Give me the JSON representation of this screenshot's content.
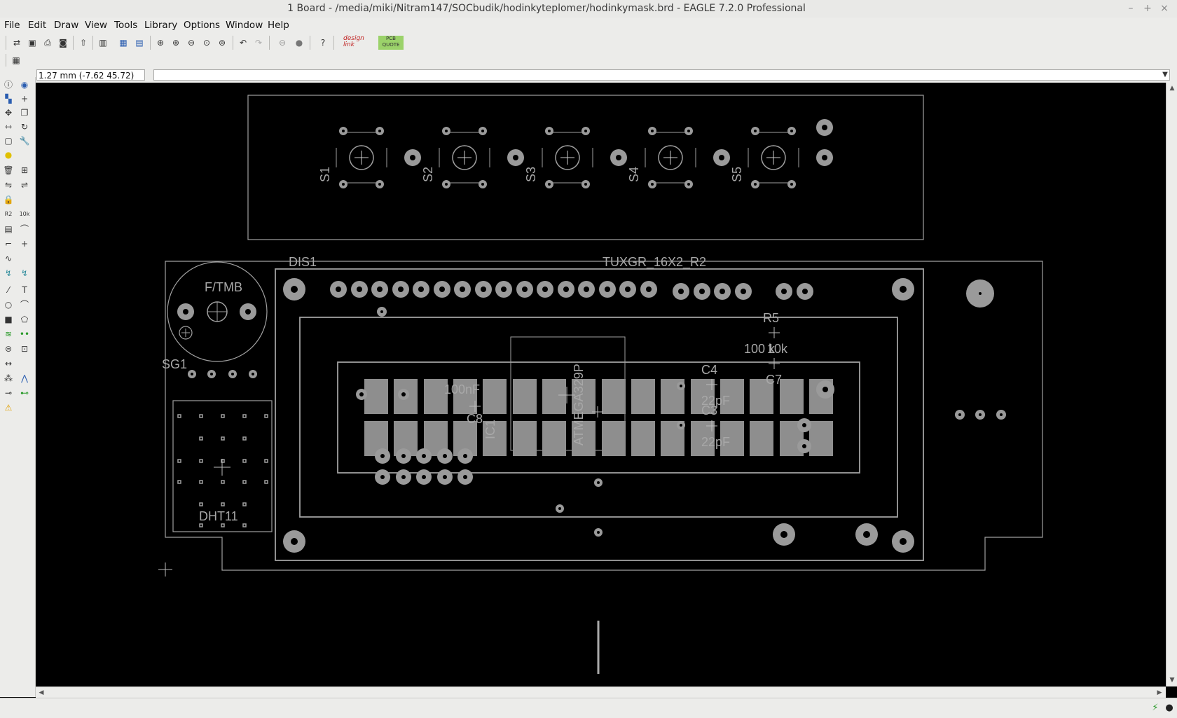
{
  "window": {
    "title": "1 Board - /media/miki/Nitram147/SOCbudik/hodinkyteplomer/hodinkymask.brd - EAGLE 7.2.0 Professional",
    "controls": [
      "–",
      "+",
      "×"
    ]
  },
  "menu": [
    "File",
    "Edit",
    "Draw",
    "View",
    "Tools",
    "Library",
    "Options",
    "Window",
    "Help"
  ],
  "toolbar": {
    "icons": [
      "open-icon",
      "save-icon",
      "print-icon",
      "cam-icon",
      "upload-icon",
      "schematic-icon",
      "board-icon",
      "zoom-fit-icon",
      "zoom-in-icon",
      "zoom-out-icon",
      "zoom-select-icon",
      "zoom-redraw-icon",
      "undo-icon",
      "redo-icon",
      "stop-icon",
      "go-icon",
      "help-icon"
    ],
    "designlink_label": "design link",
    "pcbquote_label": "PCB QUOTE"
  },
  "command": {
    "coordinate": "1.27 mm (-7.62 45.72)",
    "input_value": ""
  },
  "palette": {
    "icons": [
      "info-icon",
      "show-icon",
      "display-icon",
      "mark-icon",
      "move-icon",
      "copy-icon",
      "mirror-icon",
      "rotate-icon",
      "group-icon",
      "change-icon",
      "paste-icon",
      "delete-icon",
      "add-icon",
      "pinswap-icon",
      "replace-icon",
      "lock-icon",
      "name-icon",
      "value-icon",
      "smash-icon",
      "miter-icon",
      "split-icon",
      "optimize-icon",
      "route-icon",
      "ripup-icon",
      "wire-icon",
      "text-icon",
      "circle-icon",
      "arc-icon",
      "rect-icon",
      "polygon-icon",
      "via-icon",
      "signal-icon",
      "hole-icon",
      "attribute-icon",
      "dimension-icon",
      "ratsnest-icon",
      "autorouter-icon",
      "erc-icon",
      "drc-icon",
      "errors-icon"
    ]
  },
  "board": {
    "labels": {
      "s1": "S1",
      "s2": "S2",
      "s3": "S3",
      "s4": "S4",
      "s5": "S5",
      "dis1": "DIS1",
      "tuxgr": "TUXGR_16X2_R2",
      "ftmb": "F/TMB",
      "sg1": "SG1",
      "dht11": "DHT11",
      "r5": "R5",
      "r5_val": "100 k",
      "r5_val2": "10k",
      "c7": "C7",
      "c4": "C4",
      "c4_val": "22pF",
      "c3": "C3",
      "c3_val": "22pF",
      "c8": "C8",
      "c8_val": "100nF",
      "ic1": "IC1",
      "atmega": "ATMEGA329P"
    }
  },
  "status": {
    "text": "",
    "icons": [
      "lightning-icon",
      "stop-status-icon"
    ]
  }
}
